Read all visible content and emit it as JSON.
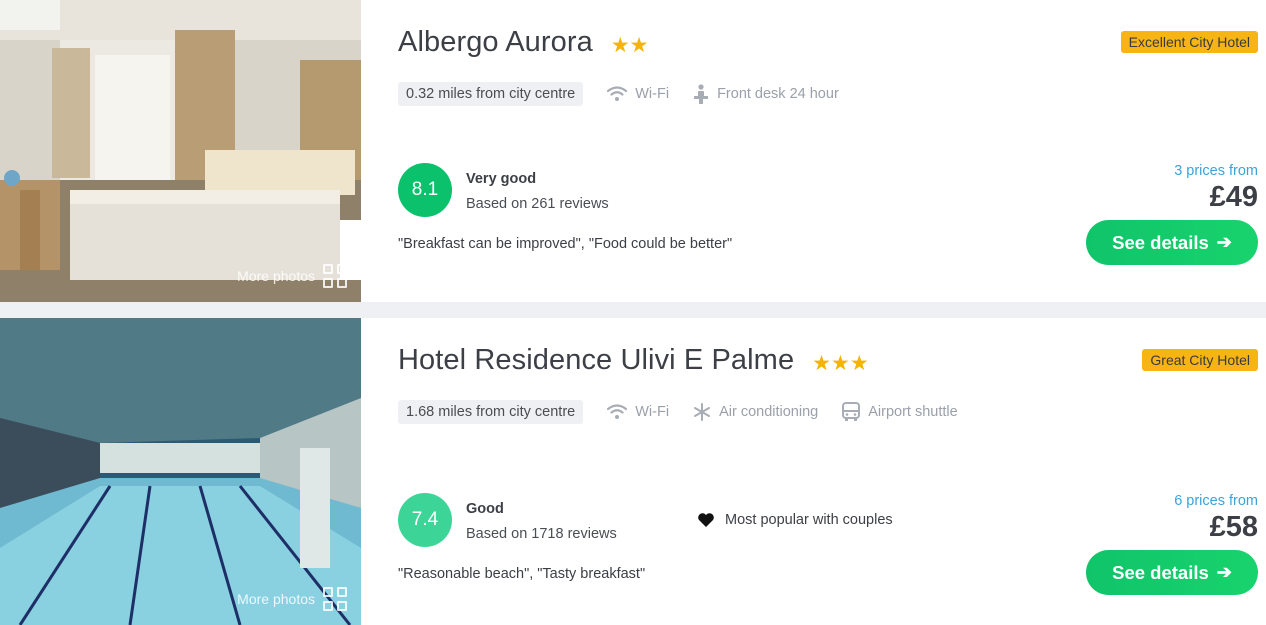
{
  "hotels": [
    {
      "name": "Albergo Aurora",
      "stars": "★★",
      "badge": "Excellent City Hotel",
      "distance": "0.32 miles from city centre",
      "amenities": [
        "Wi-Fi",
        "Front desk 24 hour"
      ],
      "score": "8.1",
      "rating_label": "Very good",
      "review_count": "Based on 261 reviews",
      "quote": "\"Breakfast can be improved\", \"Food could be better\"",
      "prices_from": "3 prices from",
      "price": "£49",
      "cta": "See details",
      "more_photos": "More photos"
    },
    {
      "name": "Hotel Residence Ulivi E Palme",
      "stars": "★★★",
      "badge": "Great City Hotel",
      "distance": "1.68 miles from city centre",
      "amenities": [
        "Wi-Fi",
        "Air conditioning",
        "Airport shuttle"
      ],
      "score": "7.4",
      "rating_label": "Good",
      "review_count": "Based on 1718 reviews",
      "quote": "\"Reasonable beach\", \"Tasty breakfast\"",
      "popular": "Most popular with couples",
      "prices_from": "6 prices from",
      "price": "£58",
      "cta": "See details",
      "more_photos": "More photos"
    }
  ],
  "colors": {
    "badge": "#f7b515",
    "cta": "#10c46a",
    "score_very_good": "#0bc16b",
    "score_good": "#3dd597",
    "prices_from": "#3ba3d8",
    "star": "#f4b400"
  },
  "icons": {
    "wifi": "wifi-icon",
    "front_desk": "front-desk-icon",
    "air_conditioning": "snowflake-icon",
    "airport_shuttle": "bus-icon",
    "popular": "heart-icon",
    "photos": "grid-icon",
    "cta_arrow": "arrow-right-icon"
  }
}
